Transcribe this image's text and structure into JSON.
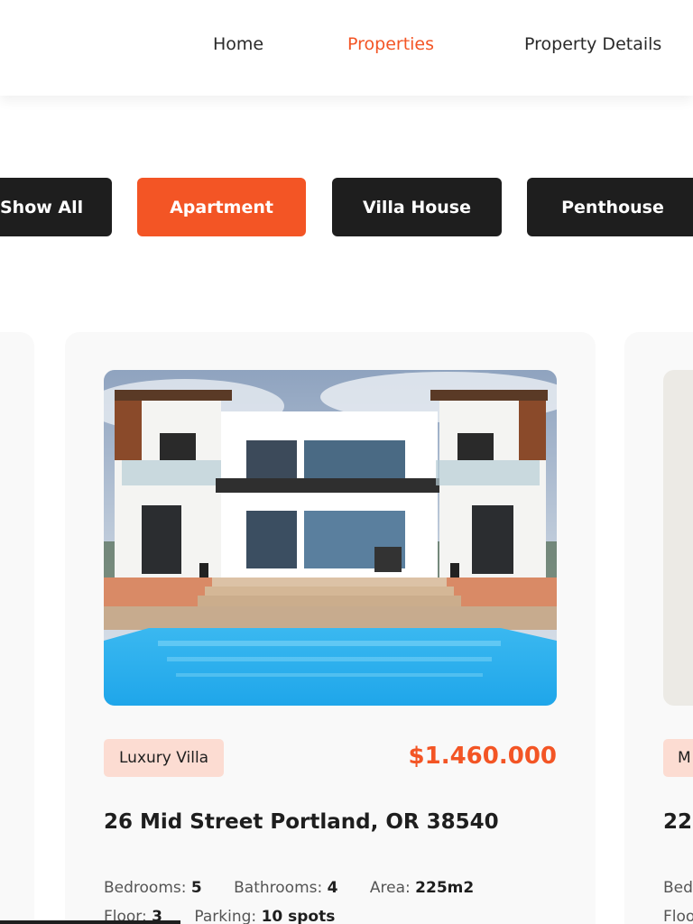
{
  "nav": {
    "items": [
      {
        "label": "Home",
        "active": false
      },
      {
        "label": "Properties",
        "active": true
      },
      {
        "label": "Property Details",
        "active": false
      }
    ]
  },
  "filters": {
    "buttons": [
      {
        "label": "Show All",
        "active": false
      },
      {
        "label": "Apartment",
        "active": true
      },
      {
        "label": "Villa House",
        "active": false
      },
      {
        "label": "Penthouse",
        "active": false
      }
    ]
  },
  "card": {
    "image_alt": "modern white villa with swimming pool",
    "category": "Luxury Villa",
    "price": "$1.460.000",
    "address": "26 Mid Street Portland, OR 38540",
    "specs": [
      {
        "label": "Bedrooms:",
        "value": "5"
      },
      {
        "label": "Bathrooms:",
        "value": "4"
      },
      {
        "label": "Area:",
        "value": "225m2"
      },
      {
        "label": "Floor:",
        "value": "3"
      },
      {
        "label": "Parking:",
        "value": "10 spots"
      }
    ]
  },
  "next_card": {
    "category_partial": "M",
    "address_partial": "22",
    "spec_partial_1": "Bed",
    "spec_partial_2": "Floo"
  },
  "colors": {
    "accent": "#f35525",
    "dark": "#1e1e1e",
    "tag_bg": "#fcdcd2",
    "card_bg": "#f9f9f9"
  }
}
